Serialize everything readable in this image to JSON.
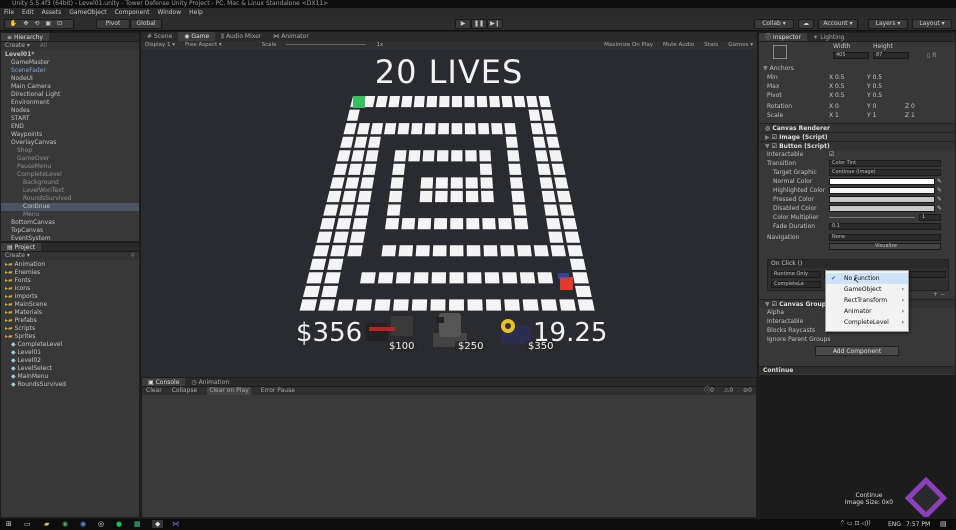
{
  "window_title": "Unity 5.5.4f3 (64bit) - Level01.unity - Tower Defense Unity Project - PC, Mac & Linux Standalone <DX11>",
  "menu": [
    "File",
    "Edit",
    "Assets",
    "GameObject",
    "Component",
    "Window",
    "Help"
  ],
  "toolbar": {
    "pivot_label": "Pivot",
    "global_label": "Global",
    "collab_label": "Collab",
    "account_label": "Account",
    "layers_label": "Layers",
    "layout_label": "Layout"
  },
  "hierarchy": {
    "tab": "Hierarchy",
    "create_label": "Create",
    "search_placeholder": "All",
    "items": [
      {
        "label": "Level01*",
        "indent": 0,
        "bold": true
      },
      {
        "label": "GameMaster",
        "indent": 1
      },
      {
        "label": "SceneFader",
        "indent": 1,
        "blue": true
      },
      {
        "label": "NodeUI",
        "indent": 1
      },
      {
        "label": "Main Camera",
        "indent": 1
      },
      {
        "label": "Directional Light",
        "indent": 1
      },
      {
        "label": "Environment",
        "indent": 1
      },
      {
        "label": "Nodes",
        "indent": 1
      },
      {
        "label": "START",
        "indent": 1
      },
      {
        "label": "END",
        "indent": 1
      },
      {
        "label": "Waypoints",
        "indent": 1
      },
      {
        "label": "OverlayCanvas",
        "indent": 1
      },
      {
        "label": "Shop",
        "indent": 2,
        "dim": true
      },
      {
        "label": "GameOver",
        "indent": 2,
        "dim": true
      },
      {
        "label": "PauseMenu",
        "indent": 2,
        "dim": true
      },
      {
        "label": "CompleteLevel",
        "indent": 2,
        "dim": true
      },
      {
        "label": "Background",
        "indent": 3,
        "dim": true
      },
      {
        "label": "LevelWonText",
        "indent": 3,
        "dim": true
      },
      {
        "label": "RoundsSurvived",
        "indent": 3,
        "dim": true
      },
      {
        "label": "Continue",
        "indent": 3,
        "selected": true
      },
      {
        "label": "Menu",
        "indent": 3,
        "dim": true
      },
      {
        "label": "BottomCanvas",
        "indent": 1
      },
      {
        "label": "TopCanvas",
        "indent": 1
      },
      {
        "label": "EventSystem",
        "indent": 1
      }
    ]
  },
  "project": {
    "tab": "Project",
    "create_label": "Create",
    "items": [
      {
        "label": "Animation",
        "folder": true
      },
      {
        "label": "Enemies",
        "folder": true
      },
      {
        "label": "Fonts",
        "folder": true
      },
      {
        "label": "Icons",
        "folder": true
      },
      {
        "label": "Imports",
        "folder": true
      },
      {
        "label": "MainScene",
        "folder": true
      },
      {
        "label": "Materials",
        "folder": true
      },
      {
        "label": "Prefabs",
        "folder": true
      },
      {
        "label": "Scripts",
        "folder": true
      },
      {
        "label": "Sprites",
        "folder": true
      },
      {
        "label": "CompleteLevel",
        "folder": false
      },
      {
        "label": "Level01",
        "folder": false
      },
      {
        "label": "Level02",
        "folder": false
      },
      {
        "label": "LevelSelect",
        "folder": false
      },
      {
        "label": "MainMenu",
        "folder": false
      },
      {
        "label": "RoundsSurvived",
        "folder": false
      }
    ]
  },
  "center_tabs": [
    "Scene",
    "Game",
    "Audio Mixer",
    "Animator"
  ],
  "game_bar": {
    "display": "Display 1",
    "aspect": "Free Aspect",
    "scale_label": "Scale",
    "scale_value": "1x",
    "maximize": "Maximize On Play",
    "mute": "Mute Audio",
    "stats": "Stats",
    "gizmos": "Gizmos"
  },
  "game": {
    "lives_text": "20 LIVES",
    "money_text": "$356",
    "countdown_text": "19.25",
    "turret_prices": [
      "$100",
      "$250",
      "$350"
    ]
  },
  "console": {
    "tabs": [
      "Console",
      "Animation"
    ],
    "buttons": [
      "Clear",
      "Collapse",
      "Clear on Play",
      "Error Pause"
    ],
    "counts": [
      "0",
      "0",
      "0"
    ]
  },
  "inspector": {
    "tabs": [
      "Inspector",
      "Lighting"
    ],
    "rect": {
      "width_label": "Width",
      "height_label": "Height",
      "width": "405",
      "height": "87"
    },
    "anchors": {
      "title": "Anchors",
      "min_label": "Min",
      "max_label": "Max",
      "pivot_label": "Pivot",
      "min_x": "0.5",
      "min_y": "0.5",
      "max_x": "0.5",
      "max_y": "0.5",
      "pivot_x": "0.5",
      "pivot_y": "0.5"
    },
    "rotation": {
      "label": "Rotation",
      "x": "0",
      "y": "0",
      "z": "0"
    },
    "scale": {
      "label": "Scale",
      "x": "1",
      "y": "1",
      "z": "1"
    },
    "components": {
      "canvas_renderer": "Canvas Renderer",
      "image_script": "Image (Script)",
      "button_script": "Button (Script)",
      "canvas_group": "Canvas Group"
    },
    "button": {
      "interactable_label": "Interactable",
      "transition_label": "Transition",
      "transition_value": "Color Tint",
      "target_graphic_label": "Target Graphic",
      "target_graphic_value": "Continue (Image)",
      "normal_color_label": "Normal Color",
      "highlighted_color_label": "Highlighted Color",
      "pressed_color_label": "Pressed Color",
      "disabled_color_label": "Disabled Color",
      "color_multiplier_label": "Color Multiplier",
      "color_multiplier_value": "1",
      "fade_duration_label": "Fade Duration",
      "fade_duration_value": "0.1",
      "navigation_label": "Navigation",
      "navigation_value": "None",
      "visualize_label": "Visualize"
    },
    "onclick": {
      "title": "On Click ()",
      "runtime": "Runtime Only",
      "function": "No Function",
      "object": "CompleteLe"
    },
    "canvas_group": {
      "alpha_label": "Alpha",
      "interactable_label": "Interactable",
      "blocks_label": "Blocks Raycasts",
      "ignore_label": "Ignore Parent Groups"
    },
    "add_component": "Add Component",
    "footer_title": "Continue",
    "preview_title": "Continue",
    "preview_size": "Image Size: 0x0"
  },
  "dropdown": {
    "items": [
      {
        "label": "No Function",
        "checked": true,
        "submenu": false
      },
      {
        "label": "GameObject",
        "checked": false,
        "submenu": true
      },
      {
        "label": "RectTransform",
        "checked": false,
        "submenu": true
      },
      {
        "label": "Animator",
        "checked": false,
        "submenu": true
      },
      {
        "label": "CompleteLevel",
        "checked": false,
        "submenu": true
      }
    ]
  },
  "taskbar": {
    "lang": "ENG",
    "time": "7:57 PM"
  },
  "colors": {
    "accent": "#4a5462",
    "editor_bg": "#383838",
    "game_bg": "#292b30",
    "tile": "#f4f4f4",
    "enemy": "#e23a2a",
    "start_cube": "#38c060"
  }
}
